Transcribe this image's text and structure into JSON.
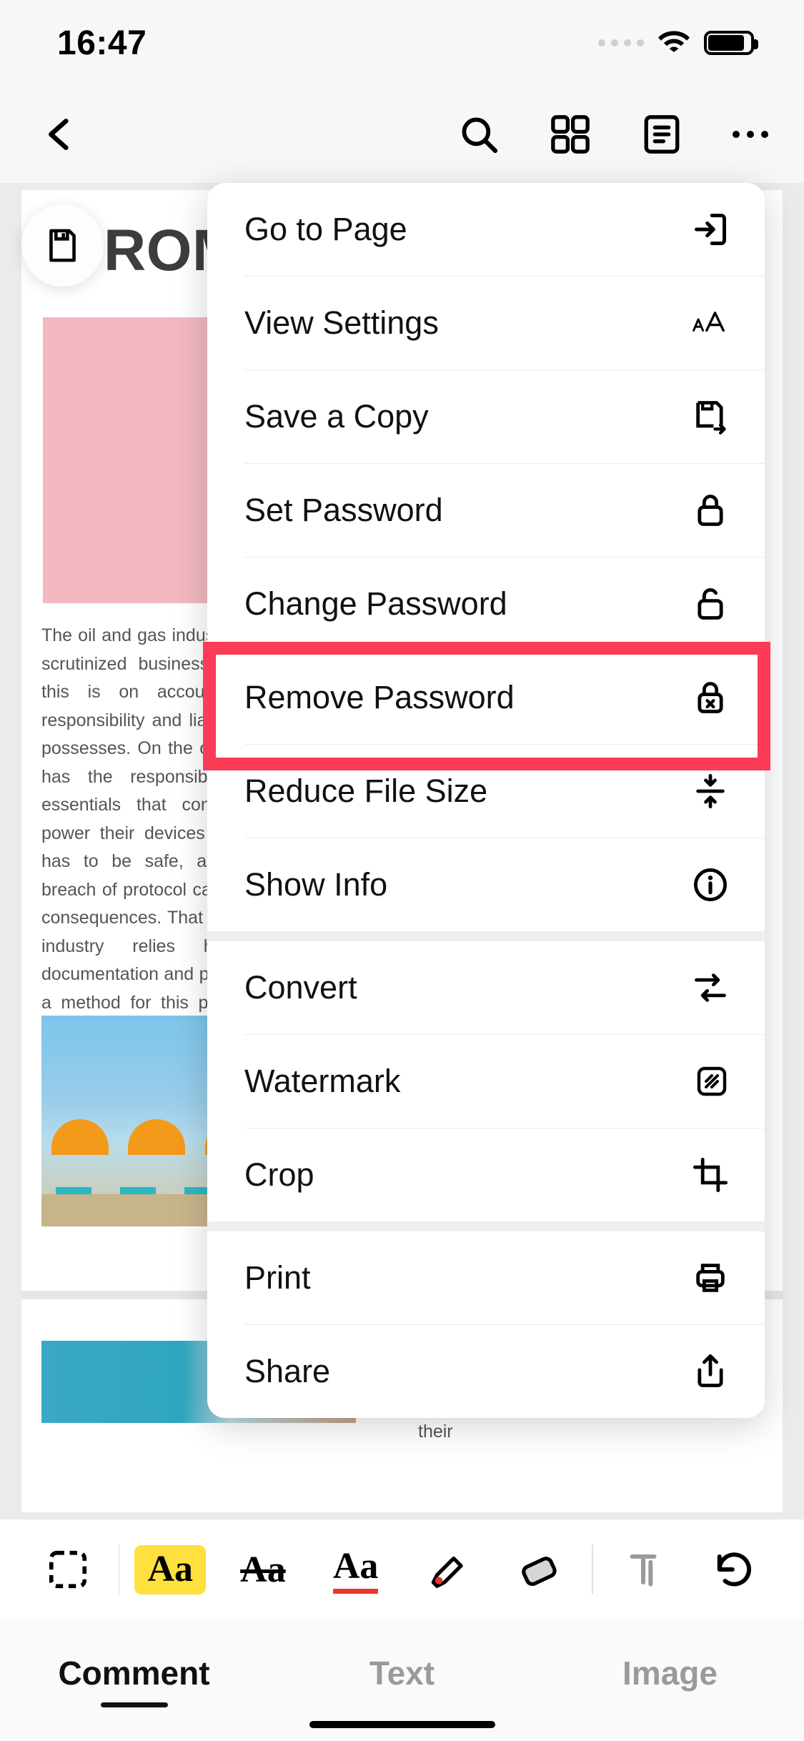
{
  "status": {
    "time": "16:47"
  },
  "menu": {
    "go_to_page": "Go to Page",
    "view_settings": "View Settings",
    "save_copy": "Save a Copy",
    "set_password": "Set Password",
    "change_password": "Change Password",
    "remove_password": "Remove Password",
    "reduce_file_size": "Reduce File Size",
    "show_info": "Show Info",
    "convert": "Convert",
    "watermark": "Watermark",
    "crop": "Crop",
    "print": "Print",
    "share": "Share"
  },
  "doc": {
    "visible_title_fragment": "ROM",
    "body_text": "The oil and gas industry is one of the most scrutinized businesses in the world and this is on account of the level of responsibility and liability that this industry possesses. On the one hand, this industry has the responsibility to provide the essentials that consumers will use to power their devices globally. Secondly, it has to be safe, as even the slightest breach of protocol can lead to catastrophic consequences. That is why the oil and gas industry relies heavily on sound documentation and paperless workflows as a method for this paperwork to enhance overall productivity and by so doing, transform the industry.",
    "side_text": "to see the increase and the decline in their"
  },
  "format_bar": {
    "highlight_sample": "Aa",
    "strike_sample": "Aa",
    "underline_sample": "Aa"
  },
  "tabs": {
    "comment": "Comment",
    "text": "Text",
    "image": "Image"
  }
}
